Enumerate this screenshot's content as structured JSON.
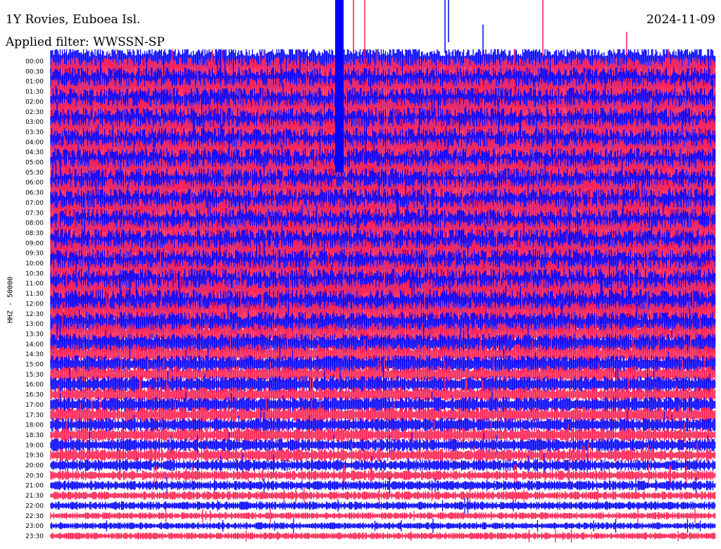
{
  "header": {
    "title": "1Y Rovies, Euboea Isl.",
    "date": "2024-11-09",
    "filter": "Applied filter: WWSSN-SP"
  },
  "chart_data": {
    "type": "line",
    "title": "1Y Rovies, Euboea Isl.",
    "ylabel": "HHZ - 50000",
    "colors": [
      "#0000ff",
      "#ff2050"
    ],
    "time_labels": [
      "00:00",
      "00:30",
      "01:00",
      "01:30",
      "02:00",
      "02:30",
      "03:00",
      "03:30",
      "04:00",
      "04:30",
      "05:00",
      "05:30",
      "06:00",
      "06:30",
      "07:00",
      "07:30",
      "08:00",
      "08:30",
      "09:00",
      "09:30",
      "10:00",
      "10:30",
      "11:00",
      "11:30",
      "12:00",
      "12:30",
      "13:00",
      "13:30",
      "14:00",
      "14:30",
      "15:00",
      "15:30",
      "16:00",
      "16:30",
      "17:00",
      "17:30",
      "18:00",
      "18:30",
      "19:00",
      "19:30",
      "20:00",
      "20:30",
      "21:00",
      "21:30",
      "22:00",
      "22:30",
      "23:00",
      "23:30"
    ],
    "row_amplitude": [
      20,
      20,
      20,
      20,
      20,
      20,
      20,
      20,
      20,
      20,
      20,
      20,
      20,
      20,
      20,
      20,
      20,
      20,
      20,
      20,
      20,
      20,
      21,
      21,
      20,
      18,
      17,
      16,
      15,
      14,
      13,
      12,
      12,
      11,
      11,
      11,
      10,
      10,
      9,
      9,
      8,
      7,
      7,
      6,
      6,
      5,
      5,
      5
    ]
  }
}
